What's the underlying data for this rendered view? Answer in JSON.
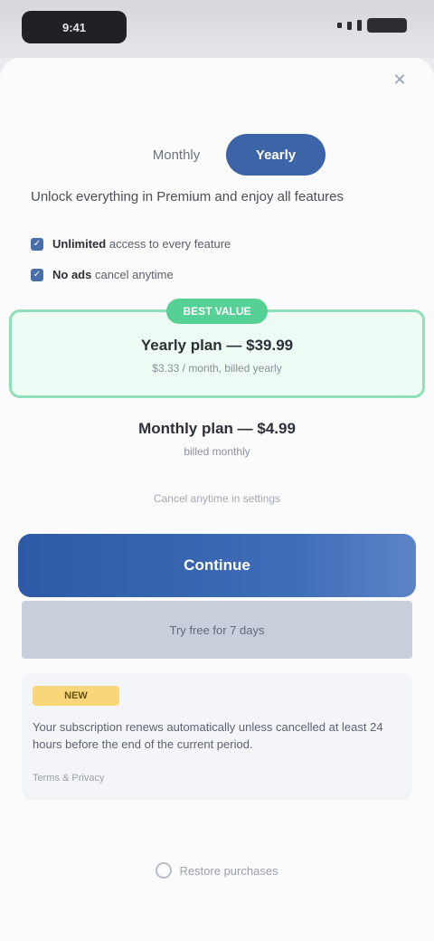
{
  "status_bar": {
    "time": "9:41"
  },
  "toggle": {
    "monthly": "Monthly",
    "yearly": "Yearly"
  },
  "heading": "Unlock everything in Premium and enjoy all features",
  "features": [
    {
      "text_a": "Unlimited",
      "text_b": "access to every feature"
    },
    {
      "text_a": "No ads",
      "text_b": "cancel anytime"
    }
  ],
  "plans": [
    {
      "badge": "BEST VALUE",
      "title": "Yearly plan — $39.99",
      "sub": "$3.33 / month, billed yearly"
    },
    {
      "title": "Monthly plan — $4.99",
      "sub": "billed monthly"
    }
  ],
  "note": "Cancel anytime in settings",
  "cta": "Continue",
  "secondary": "Try free for 7 days",
  "info": {
    "tag": "NEW",
    "text": "Your subscription renews automatically unless cancelled at least 24 hours before the end of the current period.",
    "date": "Terms & Privacy"
  },
  "restore": "Restore purchases"
}
